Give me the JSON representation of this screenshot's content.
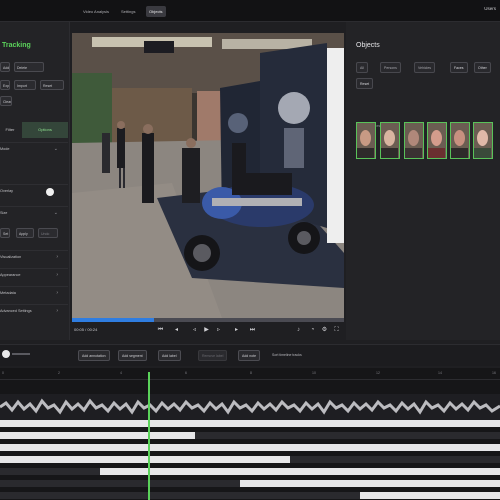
{
  "app": {
    "brand": "",
    "tabs": [
      {
        "label": "Video Analysis",
        "active": false
      },
      {
        "label": "Settings",
        "active": false
      },
      {
        "label": "Objects",
        "active": true
      }
    ],
    "user": "Users"
  },
  "left_panel": {
    "title": "Tracking",
    "buttons": [
      "Add",
      "Delete",
      "Export",
      "Import",
      "Reset",
      "Clear"
    ],
    "segments": [
      {
        "label": "Filter",
        "active": false
      },
      {
        "label": "Options",
        "active": true
      }
    ],
    "rows": [
      {
        "label": "Mode",
        "control": "chevron"
      },
      {
        "label": "Overlay",
        "control": "toggle"
      },
      {
        "label": "Size",
        "control": "chevron"
      }
    ],
    "mini_buttons": [
      "Set",
      "Apply",
      "Undo"
    ],
    "sections": [
      "Visualization",
      "Appearance",
      "Metadata",
      "Advanced Settings"
    ]
  },
  "video": {
    "timecode": "00:05 / 00:24",
    "progress": 0.3
  },
  "right_panel": {
    "title": "Objects",
    "filter_buttons": [
      "All",
      "Persons",
      "Vehicles",
      "Faces",
      "Other"
    ],
    "extra_button": "Reset",
    "faces_label": "Results  ·  Faces (6)",
    "face_count": 6
  },
  "toolbar": {
    "chips": [
      {
        "label": "Add annotation",
        "dim": false
      },
      {
        "label": "Add segment",
        "dim": false
      },
      {
        "label": "Add label",
        "dim": false
      },
      {
        "label": "Remove label",
        "dim": true
      },
      {
        "label": "Add note",
        "dim": false
      }
    ],
    "sort_label": "Sort timeline tracks"
  },
  "timeline": {
    "ticks": [
      "0",
      "2",
      "4",
      "6",
      "8",
      "10",
      "12",
      "14",
      "16"
    ],
    "playhead_fraction": 0.3
  },
  "colors": {
    "accent": "#5bd35b",
    "progress": "#2f7de1",
    "background": "#1f1f22"
  }
}
